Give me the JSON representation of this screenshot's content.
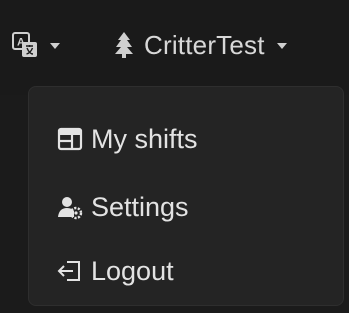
{
  "header": {
    "language_icon": "translate-icon",
    "user_icon": "user-tree-icon",
    "username": "CritterTest"
  },
  "menu": {
    "items": [
      {
        "label": "My shifts",
        "icon": "calendar-icon"
      },
      {
        "label": "Settings",
        "icon": "user-gear-icon"
      },
      {
        "label": "Logout",
        "icon": "logout-icon"
      }
    ]
  },
  "colors": {
    "background": "#1b1b1b",
    "menu_background": "#242424",
    "text": "#e3e3e3"
  }
}
